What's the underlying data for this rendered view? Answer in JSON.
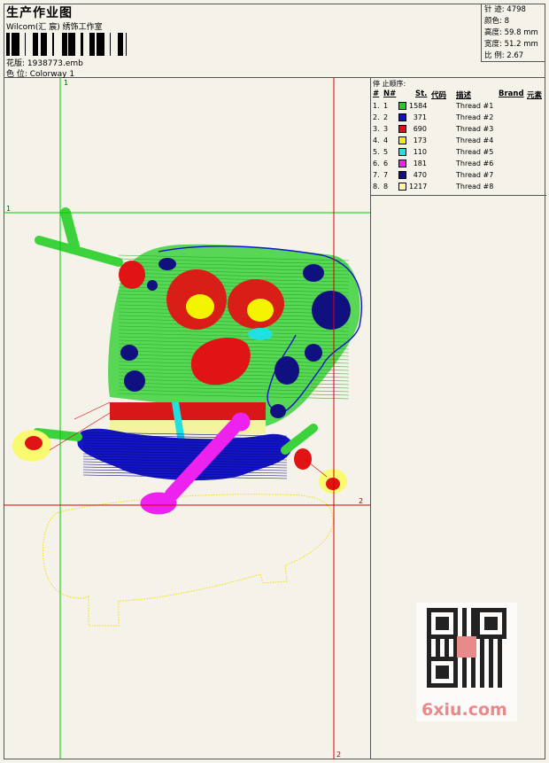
{
  "header": {
    "title": "生产作业图",
    "company": "Wilcom(汇 宸) 绣饰工作室",
    "design_label": "花版: 1938773.emb",
    "colorway_label": "色 位:  Colorway 1"
  },
  "stats": [
    {
      "label": "针 迹:",
      "value": "4798"
    },
    {
      "label": "颜色:",
      "value": "8"
    },
    {
      "label": "高度:",
      "value": "59.8 mm"
    },
    {
      "label": "宽度:",
      "value": "51.2 mm"
    },
    {
      "label": "比 例:",
      "value": "2.67"
    }
  ],
  "thread_panel": {
    "title": "停 止顺序:",
    "headers": [
      "#",
      "N#",
      "St.",
      "代码",
      "描述",
      "Brand",
      "元素"
    ],
    "rows": [
      {
        "idx": "1.",
        "n": "1",
        "color": "#22cc22",
        "st": "1584",
        "desc": "Thread #1"
      },
      {
        "idx": "2.",
        "n": "2",
        "color": "#1111cc",
        "st": "371",
        "desc": "Thread #2"
      },
      {
        "idx": "3.",
        "n": "3",
        "color": "#dd1111",
        "st": "690",
        "desc": "Thread #3"
      },
      {
        "idx": "4.",
        "n": "4",
        "color": "#f0f000",
        "st": "173",
        "desc": "Thread #4"
      },
      {
        "idx": "5.",
        "n": "5",
        "color": "#22e0e0",
        "st": "110",
        "desc": "Thread #5"
      },
      {
        "idx": "6.",
        "n": "6",
        "color": "#ee22ee",
        "st": "181",
        "desc": "Thread #6"
      },
      {
        "idx": "7.",
        "n": "7",
        "color": "#101080",
        "st": "470",
        "desc": "Thread #7"
      },
      {
        "idx": "8.",
        "n": "8",
        "color": "#fafa99",
        "st": "1217",
        "desc": "Thread #8"
      }
    ]
  },
  "guides": {
    "top_marker": "1",
    "left_marker": "1",
    "right_marker": "2",
    "bottom_marker": "2"
  },
  "watermark": "6xiu.com",
  "colors": {
    "guide_green": "#00cc00",
    "guide_red": "#dd0000",
    "watermark": "#e88a8a"
  }
}
